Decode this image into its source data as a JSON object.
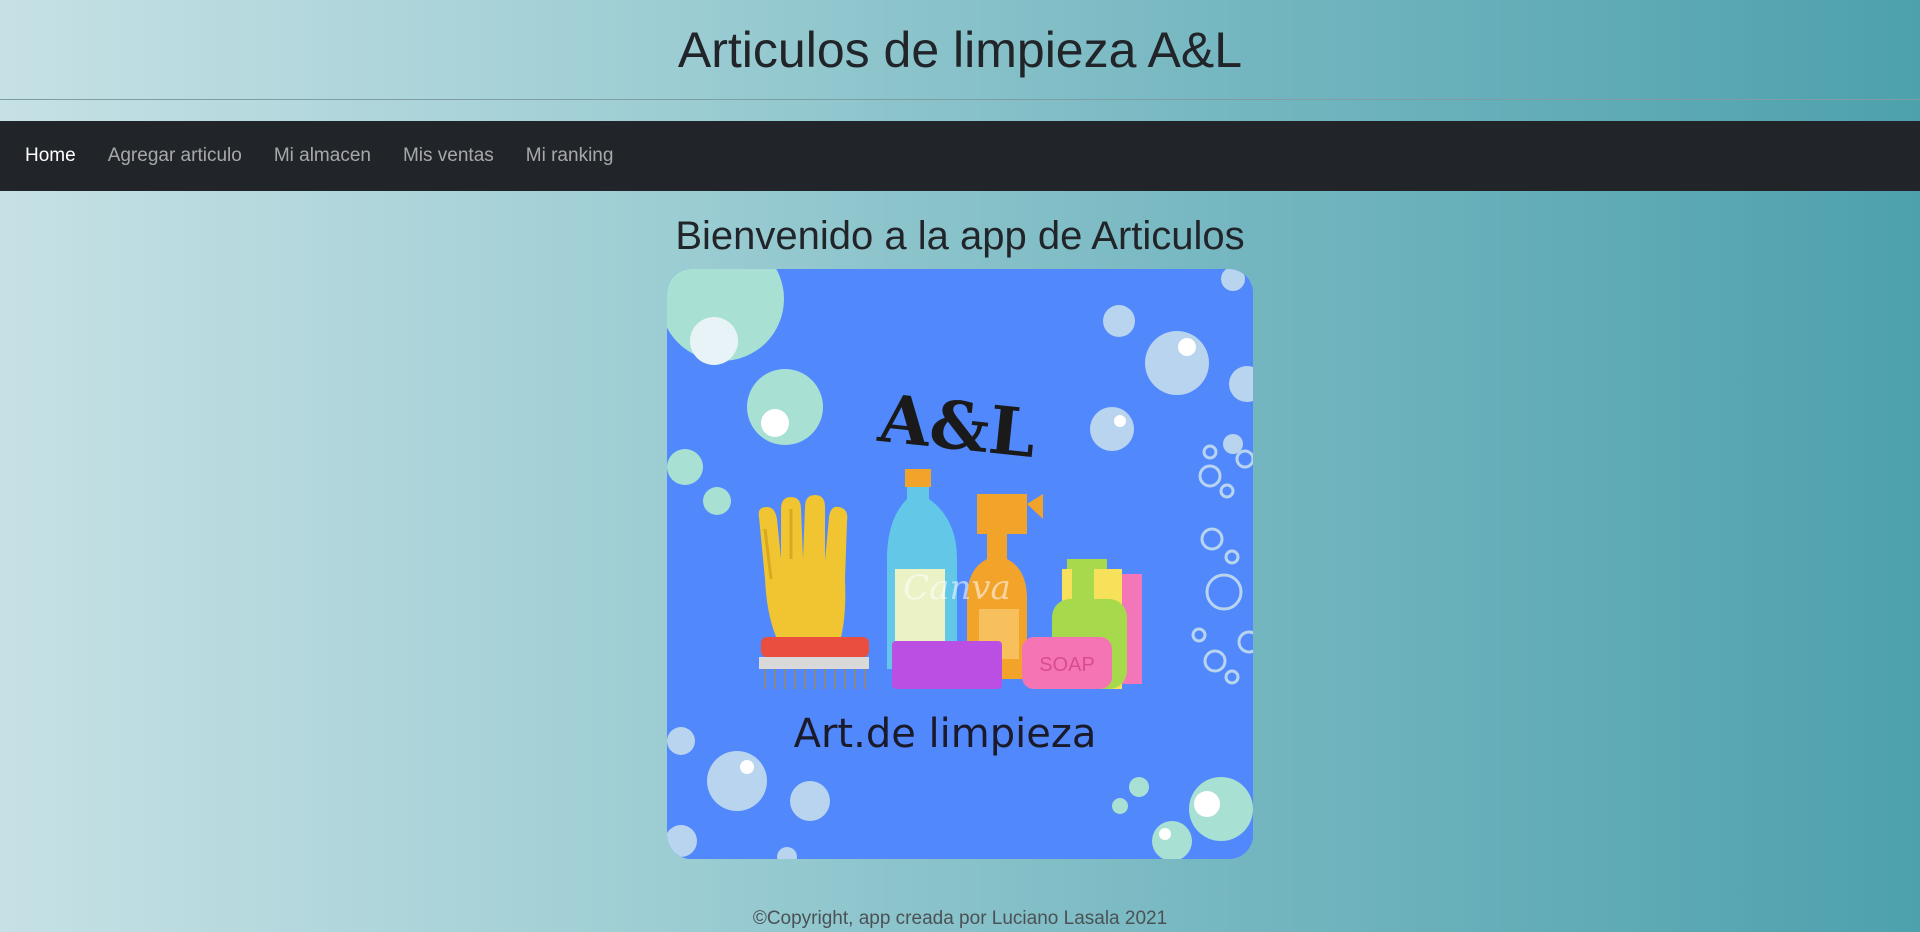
{
  "header": {
    "title": "Articulos de limpieza A&L"
  },
  "nav": {
    "items": [
      {
        "label": "Home",
        "active": true
      },
      {
        "label": "Agregar articulo",
        "active": false
      },
      {
        "label": "Mi almacen",
        "active": false
      },
      {
        "label": "Mis ventas",
        "active": false
      },
      {
        "label": "Mi ranking",
        "active": false
      }
    ]
  },
  "main": {
    "welcome": "Bienvenido a la app de Articulos",
    "logo": {
      "brand": "A&L",
      "caption": "Art.de limpieza",
      "soap_label": "SOAP",
      "watermark": "Canva"
    }
  },
  "footer": {
    "copyright": "©Copyright, app creada por Luciano Lasala 2021"
  },
  "colors": {
    "navbar_bg": "#212529",
    "logo_bg": "#5188fc",
    "text": "#212529"
  }
}
